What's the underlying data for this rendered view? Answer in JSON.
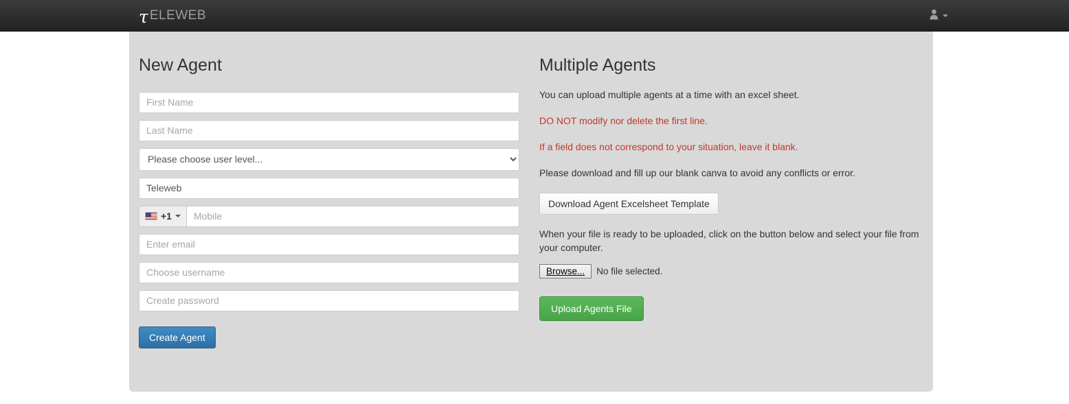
{
  "navbar": {
    "brand_symbol": "τ",
    "brand_text": "ELEWEB",
    "user_icon": "user-icon",
    "caret_icon": "caret-down-icon"
  },
  "new_agent": {
    "title": "New Agent",
    "fields": {
      "first_name_placeholder": "First Name",
      "last_name_placeholder": "Last Name",
      "user_level_selected": "Please choose user level...",
      "company_value": "Teleweb",
      "dial_code": "+1",
      "flag_icon": "us-flag-icon",
      "mobile_placeholder": "Mobile",
      "email_placeholder": "Enter email",
      "username_placeholder": "Choose username",
      "password_placeholder": "Create password"
    },
    "submit_label": "Create Agent"
  },
  "multiple_agents": {
    "title": "Multiple Agents",
    "intro": "You can upload multiple agents at a time with an excel sheet.",
    "warning_1": "DO NOT modify nor delete the first line.",
    "warning_2": "If a field does not correspond to your situation, leave it blank.",
    "download_note": "Please download and fill up our blank canva to avoid any conflicts or error.",
    "download_label": "Download Agent Excelsheet Template",
    "upload_note": "When your file is ready to be uploaded, click on the button below and select your file from your computer.",
    "browse_label": "Browse...",
    "file_status": "No file selected.",
    "upload_label": "Upload Agents File"
  },
  "colors": {
    "navbar_bg": "#222222",
    "panel_bg": "#d9d9d9",
    "primary": "#2f6fa5",
    "success": "#47a447",
    "warning_text": "#c0392b"
  }
}
